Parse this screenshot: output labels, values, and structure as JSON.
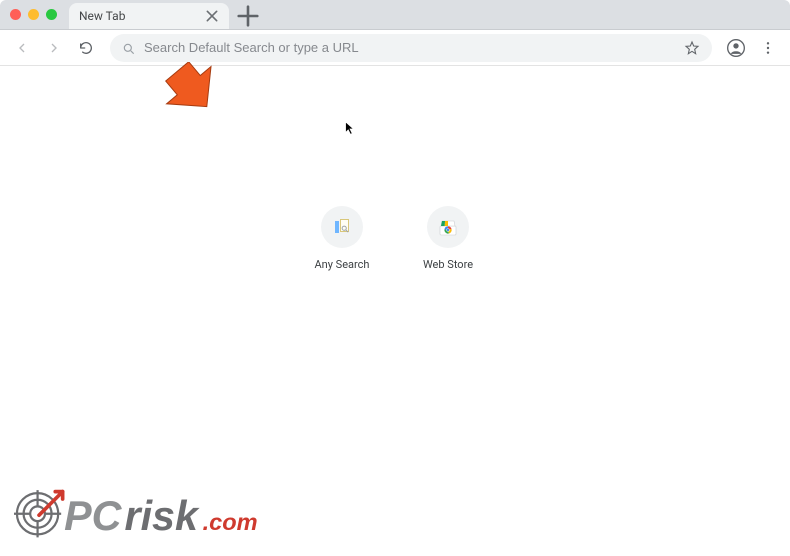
{
  "window": {
    "tab_title": "New Tab"
  },
  "toolbar": {
    "omnibox_placeholder": "Search Default Search or type a URL"
  },
  "shortcuts": [
    {
      "label": "Any Search",
      "icon": "anysearch"
    },
    {
      "label": "Web Store",
      "icon": "webstore"
    }
  ],
  "watermark": {
    "text_pc": "PC",
    "text_risk": "risk",
    "text_com": ".com"
  }
}
